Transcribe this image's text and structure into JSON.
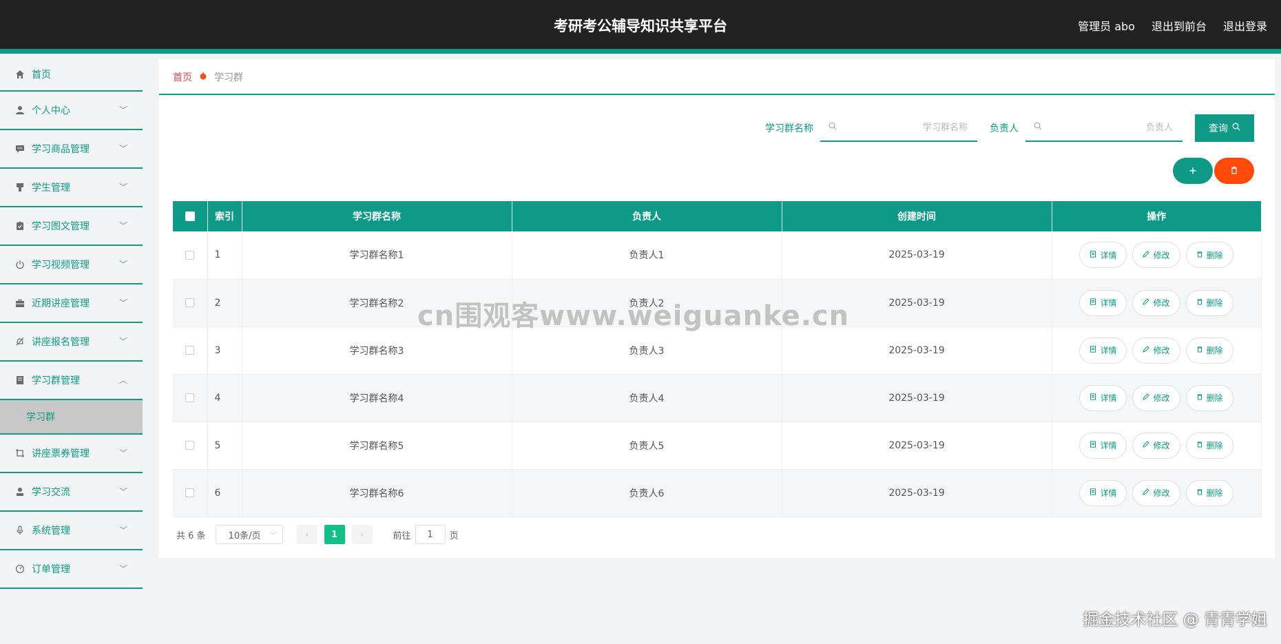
{
  "header": {
    "title": "考研考公辅导知识共享平台",
    "user": "管理员 abo",
    "to_front": "退出到前台",
    "logout": "退出登录"
  },
  "sidebar": {
    "home": "首页",
    "items": [
      {
        "label": "个人中心",
        "icon": "user-icon"
      },
      {
        "label": "学习商品管理",
        "icon": "chat-icon"
      },
      {
        "label": "学生管理",
        "icon": "stamp-icon"
      },
      {
        "label": "学习图文管理",
        "icon": "clipboard-check-icon"
      },
      {
        "label": "学习视频管理",
        "icon": "power-icon"
      },
      {
        "label": "近期讲座管理",
        "icon": "briefcase-icon"
      },
      {
        "label": "讲座报名管理",
        "icon": "bell-off-icon"
      },
      {
        "label": "学习群管理",
        "icon": "notebook-icon"
      },
      {
        "label": "讲座票券管理",
        "icon": "crop-icon"
      },
      {
        "label": "学习交流",
        "icon": "user-icon"
      },
      {
        "label": "系统管理",
        "icon": "microphone-icon"
      },
      {
        "label": "订单管理",
        "icon": "gauge-icon"
      }
    ],
    "sub_active": "学习群"
  },
  "breadcrumb": {
    "home": "首页",
    "current": "学习群"
  },
  "search": {
    "name_label": "学习群名称",
    "name_placeholder": "学习群名称",
    "owner_label": "负责人",
    "owner_placeholder": "负责人",
    "query_label": "查询"
  },
  "actions": {
    "add_symbol": "+",
    "delete_symbol": "🗑"
  },
  "table": {
    "headers": {
      "index": "索引",
      "name": "学习群名称",
      "owner": "负责人",
      "created": "创建时间",
      "ops": "操作"
    },
    "ops": {
      "detail": "详情",
      "edit": "修改",
      "delete": "删除"
    },
    "rows": [
      {
        "index": "1",
        "name": "学习群名称1",
        "owner": "负责人1",
        "created": "2025-03-19"
      },
      {
        "index": "2",
        "name": "学习群名称2",
        "owner": "负责人2",
        "created": "2025-03-19"
      },
      {
        "index": "3",
        "name": "学习群名称3",
        "owner": "负责人3",
        "created": "2025-03-19"
      },
      {
        "index": "4",
        "name": "学习群名称4",
        "owner": "负责人4",
        "created": "2025-03-19"
      },
      {
        "index": "5",
        "name": "学习群名称5",
        "owner": "负责人5",
        "created": "2025-03-19"
      },
      {
        "index": "6",
        "name": "学习群名称6",
        "owner": "负责人6",
        "created": "2025-03-19"
      }
    ]
  },
  "pagination": {
    "total": "共 6 条",
    "page_size": "10条/页",
    "prev": "‹",
    "page": "1",
    "next": "›",
    "goto_prefix": "前往",
    "goto_value": "1",
    "goto_suffix": "页"
  },
  "watermarks": {
    "center": "cn围观客www.weiguanke.cn",
    "bottom_right": "掘金技术社区 @ 青青学姐"
  },
  "colors": {
    "accent": "#0f9a87",
    "header_bg": "#222222",
    "danger": "#ff4a0a",
    "page_active": "#0fc087"
  }
}
